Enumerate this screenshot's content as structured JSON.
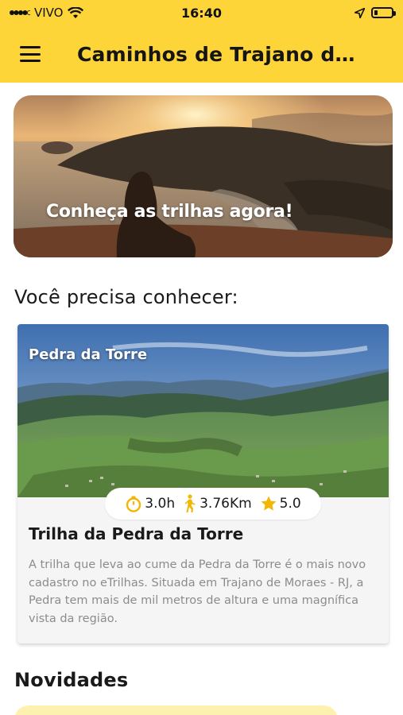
{
  "status_bar": {
    "carrier": "VIVO",
    "time": "16:40",
    "battery_level": 0.2
  },
  "app_bar": {
    "title": "Caminhos de Trajano de Moraes"
  },
  "hero": {
    "caption": "Conheça as trilhas agora!"
  },
  "sections": {
    "featured_title": "Você precisa conhecer:",
    "news_title": "Novidades"
  },
  "featured_card": {
    "image_label": "Pedra da Torre",
    "duration": "3.0h",
    "distance": "3.76Km",
    "rating": "5.0",
    "title": "Trilha da Pedra da Torre",
    "description": "A trilha que leva ao cume da Pedra da Torre é o mais novo cadastro no eTrilhas. Situada em Trajano de Moraes - RJ, a Pedra tem mais de mil metros de altura e uma magnífica vista da região."
  },
  "colors": {
    "accent": "#fdd538",
    "stat_icon": "#f2b705"
  },
  "icons": {
    "menu": "hamburger-icon",
    "duration": "stopwatch-icon",
    "distance": "hiker-icon",
    "rating": "star-icon"
  }
}
